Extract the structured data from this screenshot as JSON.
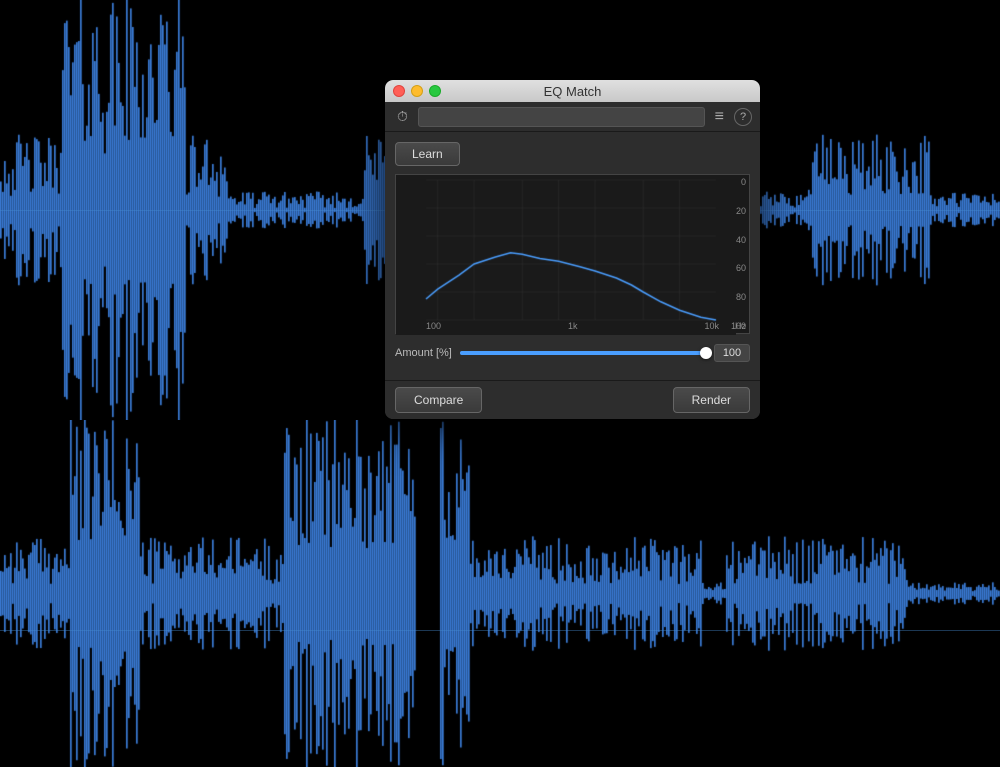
{
  "window": {
    "title": "EQ Match",
    "traffic_lights": {
      "close": "close",
      "minimize": "minimize",
      "maximize": "maximize"
    }
  },
  "toolbar": {
    "automation_icon": "⏱",
    "dropdown_placeholder": "",
    "menu_icon": "≡",
    "help_icon": "?"
  },
  "plugin": {
    "learn_button": "Learn",
    "compare_button": "Compare",
    "render_button": "Render",
    "amount_label": "Amount [%]",
    "amount_value": "100"
  },
  "eq_graph": {
    "y_labels": [
      "0",
      "20",
      "40",
      "60",
      "80",
      "100"
    ],
    "x_labels": [
      "100",
      "1k",
      "10k"
    ],
    "hz_label": "Hz"
  },
  "waveform": {
    "color": "#3a7bd5",
    "background": "#000000"
  }
}
